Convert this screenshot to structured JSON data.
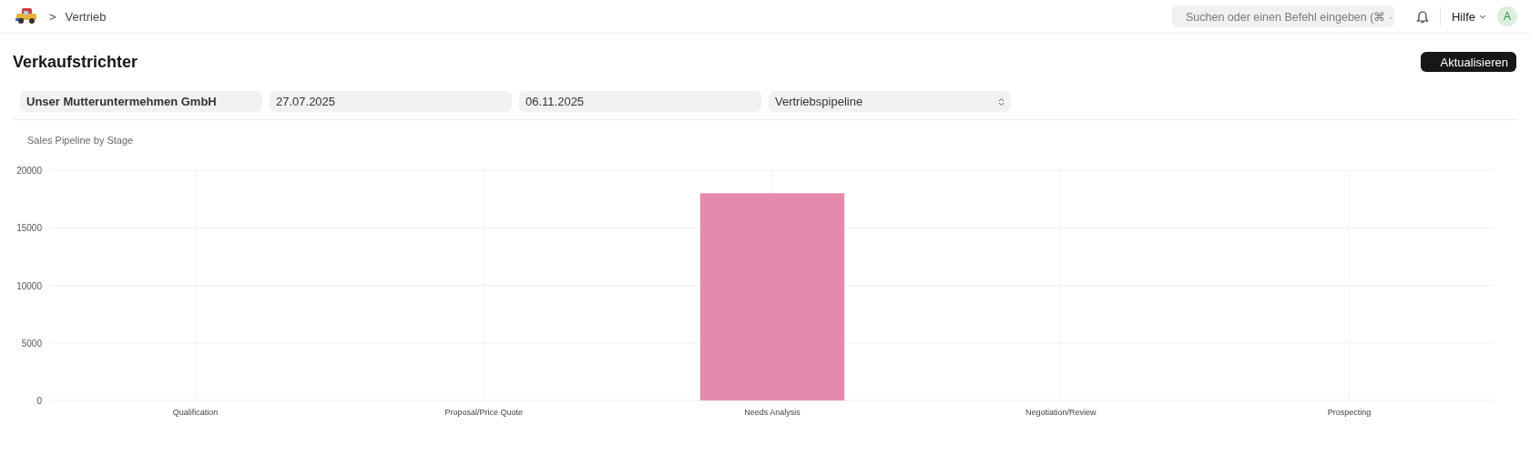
{
  "breadcrumb": {
    "separator": ">",
    "items": [
      "Vertrieb"
    ]
  },
  "search": {
    "placeholder": "Suchen oder einen Befehl eingeben (⌘ ·"
  },
  "help_menu": {
    "label": "Hilfe"
  },
  "avatar": {
    "initial": "A"
  },
  "page": {
    "title": "Verkaufstrichter",
    "primary_button": "Aktualisieren"
  },
  "filters": [
    {
      "kind": "text",
      "value": "Unser Mutteruntermehmen GmbH",
      "bold": true
    },
    {
      "kind": "text",
      "value": "27.07.2025",
      "bold": false
    },
    {
      "kind": "text",
      "value": "06.11.2025",
      "bold": false
    },
    {
      "kind": "select",
      "value": "Vertriebspipeline",
      "bold": false
    }
  ],
  "chart": {
    "chart_data": {
      "type": "bar",
      "title": "Sales Pipeline by Stage",
      "categories": [
        "Qualification",
        "Proposal/Price Quote",
        "Needs Analysis",
        "Negotiation/Review",
        "Prospecting"
      ],
      "series": [
        {
          "color": "#e68aad",
          "values": [
            0,
            0,
            18000,
            0,
            0
          ]
        }
      ],
      "grid": true,
      "ylim": [
        0,
        20000
      ],
      "yticks": [
        0,
        5000,
        10000,
        15000,
        20000
      ]
    }
  }
}
